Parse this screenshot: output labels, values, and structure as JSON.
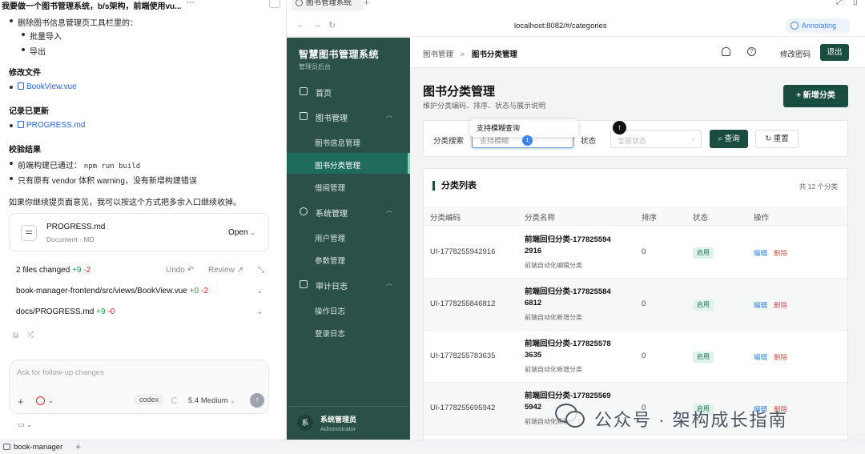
{
  "chat": {
    "title": "我要做一个图书管理系统，b/s架构，前端使用vu...",
    "more": "···",
    "intro": "删除图书信息管理页工具栏里的：",
    "removed_items": [
      "批量导入",
      "导出"
    ],
    "modified_heading": "修改文件",
    "modified_file": "BookView.vue",
    "record_heading": "记录已更新",
    "record_file": "PROGRESS.md",
    "verify_heading": "校验结果",
    "verify_build_prefix": "前端构建已通过：",
    "verify_build_cmd": "npm run build",
    "verify_warning": "只有原有 vendor 体积 warning，没有新增构建错误",
    "closing": "如果你继续提页面意见，我可以按这个方式把多余入口继续收掉。",
    "file_card": {
      "name": "PROGRESS.md",
      "meta": "Document · MD",
      "open": "Open"
    },
    "changes": {
      "summary": "2 files changed",
      "added": "+9",
      "removed": "-2",
      "undo": "Undo",
      "review": "Review",
      "files": [
        {
          "path": "book-manager-frontend/src/views/BookView.vue",
          "added": "+0",
          "removed": "-2"
        },
        {
          "path": "docs/PROGRESS.md",
          "added": "+9",
          "removed": "-0"
        }
      ]
    },
    "composer": {
      "placeholder": "Ask for follow-up changes",
      "mode": "codex",
      "model": "5.4 Medium"
    }
  },
  "bottom_tab": "book-manager",
  "browser": {
    "tab_title": "图书管理系统",
    "url": "localhost:8082/#/categories",
    "annotating": "Annotating"
  },
  "app": {
    "brand": "智慧图书管理系统",
    "brand_sub": "管理员后台",
    "menu": {
      "home": "首页",
      "books": "图书管理",
      "book_info": "图书信息管理",
      "book_category": "图书分类管理",
      "borrow": "借阅管理",
      "system": "系统管理",
      "users": "用户管理",
      "params": "参数管理",
      "audit": "审计日志",
      "op_log": "操作日志",
      "login_log": "登录日志"
    },
    "user": {
      "avatar": "系",
      "name": "系统管理员",
      "role": "Administrator"
    },
    "breadcrumb": {
      "parent": "图书管理",
      "sep": ">",
      "current": "图书分类管理"
    },
    "header": {
      "change_password": "修改密码",
      "logout": "退出"
    },
    "page": {
      "title": "图书分类管理",
      "desc": "维护分类编码、排序、状态与展示说明",
      "new_button": "+ 新增分类"
    },
    "filter": {
      "search_label": "分类搜索",
      "search_value": "支持模糊",
      "status_label": "状态",
      "status_placeholder": "全部状态",
      "query": "查询",
      "reset": "重置",
      "tooltip": "支持模糊查询",
      "pin": "1"
    },
    "table": {
      "title": "分类列表",
      "count": "共 12 个分类",
      "headers": [
        "分类编码",
        "分类名称",
        "排序",
        "状态",
        "操作"
      ],
      "rows": [
        {
          "code": "UI-1778255942916",
          "name": "前端回归分类-1778255942916",
          "desc": "前端自动化编辑分类",
          "sort": "0",
          "status": "启用"
        },
        {
          "code": "UI-1778255846812",
          "name": "前端回归分类-1778255846812",
          "desc": "前端自动化新增分类",
          "sort": "0",
          "status": "启用"
        },
        {
          "code": "UI-1778255783635",
          "name": "前端回归分类-1778255783635",
          "desc": "前端自动化新增分类",
          "sort": "0",
          "status": "启用"
        },
        {
          "code": "UI-1778255695942",
          "name": "前端回归分类-1778255695942",
          "desc": "前端自动化新增分类",
          "sort": "0",
          "status": "启用"
        }
      ],
      "edit": "编辑",
      "delete": "删除"
    }
  },
  "watermark": "公众号 · 架构成长指南"
}
